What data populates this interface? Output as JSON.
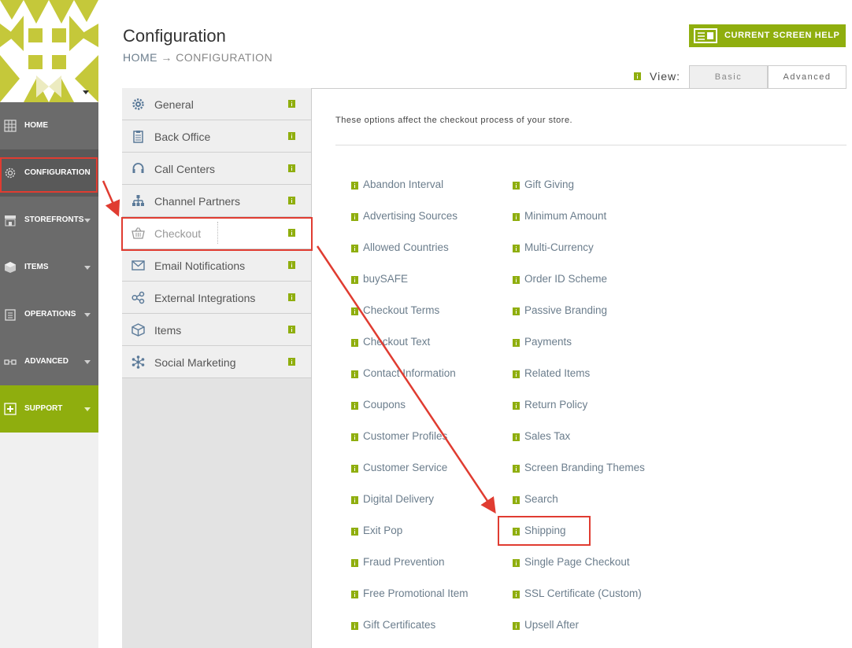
{
  "header": {
    "title": "Configuration",
    "breadcrumb_home": "HOME",
    "breadcrumb_arrow": "→",
    "breadcrumb_current": "CONFIGURATION"
  },
  "help_button": {
    "label": "CURRENT SCREEN HELP"
  },
  "view": {
    "label": "View:",
    "tabs": [
      "Basic",
      "Advanced"
    ],
    "selected": "Advanced"
  },
  "leftnav": {
    "items": [
      {
        "label": "HOME",
        "icon": "home-grid-icon"
      },
      {
        "label": "CONFIGURATION",
        "icon": "gear-icon"
      },
      {
        "label": "STOREFRONTS",
        "icon": "storefront-icon"
      },
      {
        "label": "ITEMS",
        "icon": "box-icon"
      },
      {
        "label": "OPERATIONS",
        "icon": "clipboard-icon"
      },
      {
        "label": "ADVANCED",
        "icon": "glasses-icon"
      },
      {
        "label": "SUPPORT",
        "icon": "plus-square-icon"
      }
    ],
    "active": "CONFIGURATION"
  },
  "menu": {
    "items": [
      {
        "label": "General",
        "icon": "gear-icon"
      },
      {
        "label": "Back Office",
        "icon": "clipboard-icon"
      },
      {
        "label": "Call Centers",
        "icon": "headset-icon"
      },
      {
        "label": "Channel Partners",
        "icon": "org-chart-icon"
      },
      {
        "label": "Checkout",
        "icon": "basket-icon"
      },
      {
        "label": "Email Notifications",
        "icon": "envelope-icon"
      },
      {
        "label": "External Integrations",
        "icon": "share-nodes-icon"
      },
      {
        "label": "Items",
        "icon": "cube-icon"
      },
      {
        "label": "Social Marketing",
        "icon": "snowflake-icon"
      }
    ],
    "active": "Checkout"
  },
  "content": {
    "intro": "These options affect the checkout process of your store.",
    "options_col1": [
      "Abandon Interval",
      "Advertising Sources",
      "Allowed Countries",
      "buySAFE",
      "Checkout Terms",
      "Checkout Text",
      "Contact Information",
      "Coupons",
      "Customer Profiles",
      "Customer Service",
      "Digital Delivery",
      "Exit Pop",
      "Fraud Prevention",
      "Free Promotional Item",
      "Gift Certificates"
    ],
    "options_col2": [
      "Gift Giving",
      "Minimum Amount",
      "Multi-Currency",
      "Order ID Scheme",
      "Passive Branding",
      "Payments",
      "Related Items",
      "Return Policy",
      "Sales Tax",
      "Screen Branding Themes",
      "Search",
      "Shipping",
      "Single Page Checkout",
      "SSL Certificate (Custom)",
      "Upsell After"
    ]
  },
  "colors": {
    "accent": "#8fae0e",
    "nav_bg": "#6b6b6b",
    "annotation": "#e03c31",
    "link": "#6b7d8c"
  }
}
